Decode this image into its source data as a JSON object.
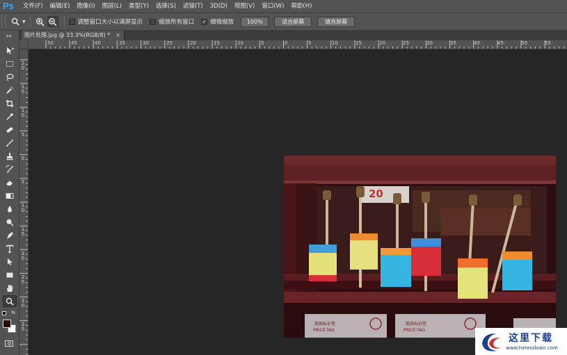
{
  "app": {
    "logo": "Ps"
  },
  "menu": [
    "文件(F)",
    "编辑(E)",
    "图像(I)",
    "图层(L)",
    "类型(Y)",
    "选择(S)",
    "滤镜(T)",
    "3D(D)",
    "视图(V)",
    "窗口(W)",
    "帮助(H)"
  ],
  "options": {
    "tool_icon": "zoom-icon",
    "checkboxes": [
      {
        "label": "调整窗口大小以满屏显示",
        "checked": false
      },
      {
        "label": "缩放所有窗口",
        "checked": false
      },
      {
        "label": "细微缩放",
        "checked": true
      }
    ],
    "zoom_button": "100%",
    "fit_screen_button": "适合屏幕",
    "fill_screen_button": "填充屏幕"
  },
  "document_tab": {
    "title": "图片处理.jpg @ 33.3%(RGB/8) *",
    "close": "×"
  },
  "ruler_h": [
    "50",
    "45",
    "40",
    "35",
    "30",
    "25",
    "20",
    "15",
    "10",
    "5",
    "0",
    "5",
    "10",
    "15",
    "20",
    "25",
    "30",
    "35",
    "40",
    "45",
    "50",
    "55"
  ],
  "ruler_v": [
    "2|0",
    "1|5",
    "1|0",
    "5",
    "0",
    "5",
    "1|0",
    "1|5",
    "2|0",
    "2|5",
    "3|0",
    "3|5"
  ],
  "tools": [
    "move-icon",
    "marquee-icon",
    "lasso-icon",
    "quick-select-icon",
    "crop-icon",
    "eyedropper-icon",
    "healing-icon",
    "brush-icon",
    "stamp-icon",
    "history-brush-icon",
    "eraser-icon",
    "gradient-icon",
    "blur-icon",
    "dodge-icon",
    "pen-icon",
    "type-icon",
    "path-select-icon",
    "rectangle-icon",
    "hand-icon",
    "zoom-icon"
  ],
  "colors": {
    "foreground": "#2a0a08",
    "background": "#ffffff",
    "accent": "#31a8ff"
  },
  "watermark": {
    "text": "这里下载",
    "url": "www.hereodown.com"
  }
}
